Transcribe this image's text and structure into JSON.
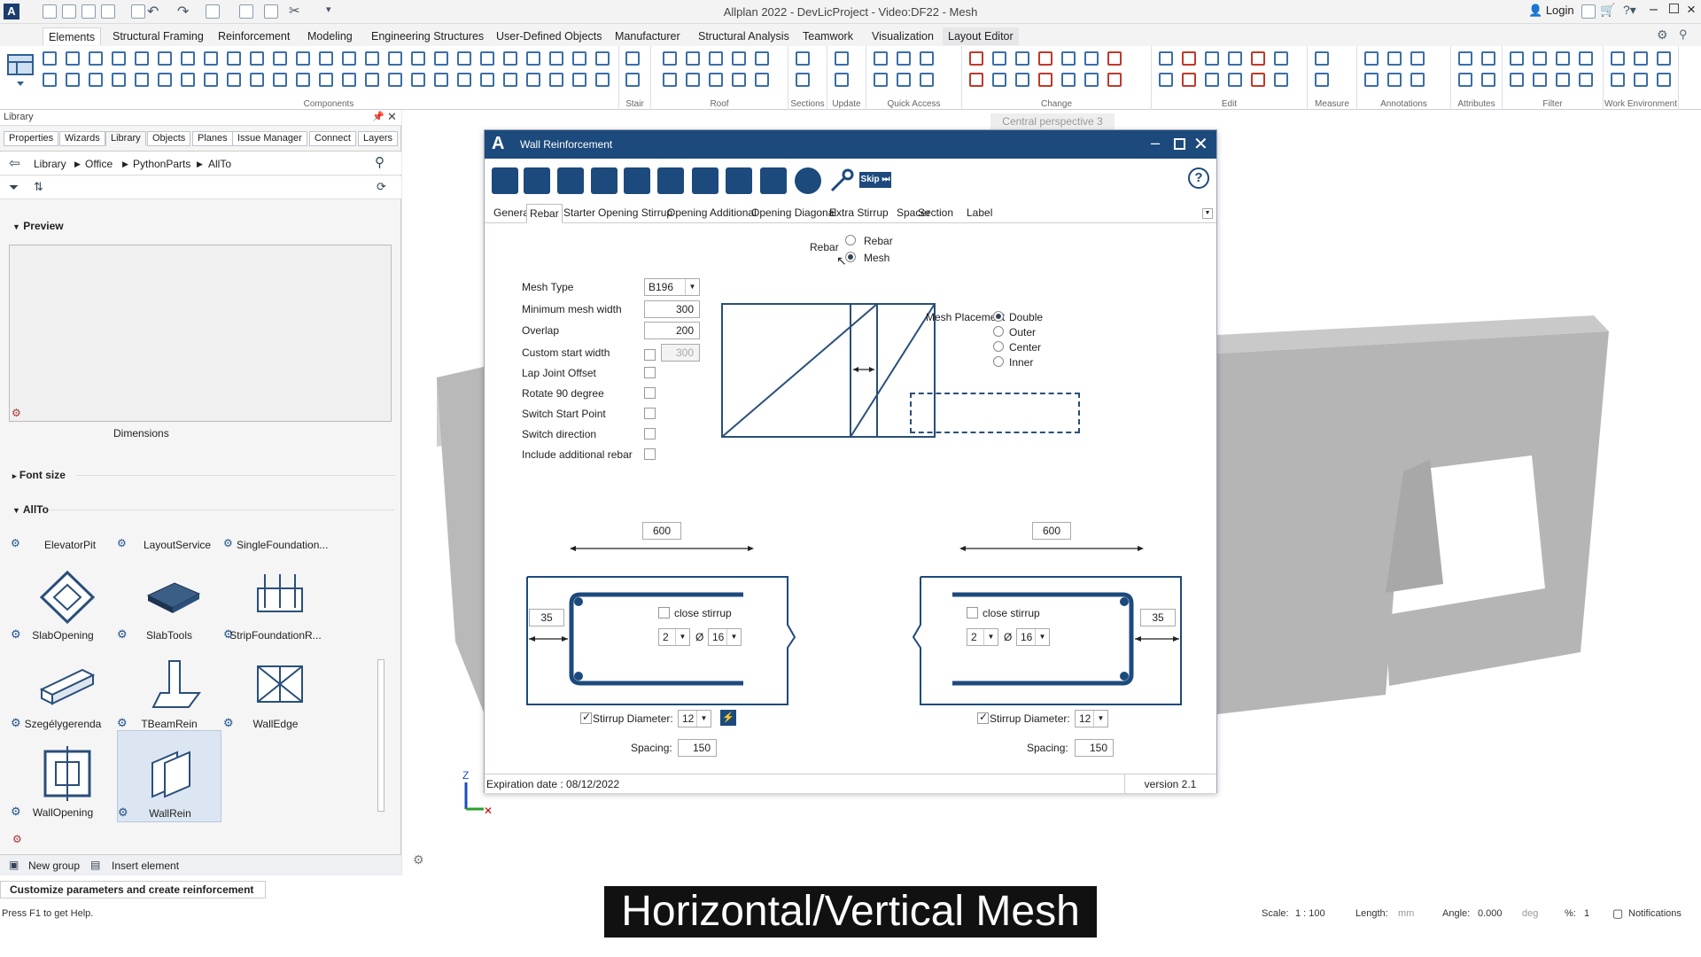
{
  "app": {
    "title": "Allplan 2022 - DevLicProject - Video:DF22 - Mesh",
    "login": "Login"
  },
  "ribbon": {
    "tabs": [
      "Elements",
      "Structural Framing",
      "Reinforcement",
      "Modeling",
      "Engineering Structures",
      "User-Defined Objects",
      "Manufacturer",
      "Structural Analysis",
      "Teamwork",
      "Visualization",
      "Layout Editor"
    ],
    "groups": [
      "Components",
      "Stair",
      "Roof",
      "Sections",
      "Update",
      "Quick Access",
      "Change",
      "Edit",
      "Measure",
      "Annotations",
      "Attributes",
      "Filter",
      "Work Environment"
    ]
  },
  "left_panel": {
    "header": "Library",
    "tabs": [
      "Properties",
      "Wizards",
      "Library",
      "Objects",
      "Planes",
      "Issue Manager",
      "Connect",
      "Layers"
    ],
    "breadcrumb": [
      "Library",
      "Office",
      "PythonParts",
      "AllTo"
    ],
    "preview_label": "Preview",
    "dimensions_label": "Dimensions",
    "font_size_label": "Font size",
    "group_label": "AllTo",
    "top_items": [
      "ElevatorPit",
      "LayoutService",
      "SingleFoundation..."
    ],
    "items": [
      "SlabOpening",
      "SlabTools",
      "StripFoundationR...",
      "Szegélygerenda",
      "TBeamRein",
      "WallEdge",
      "WallOpening",
      "WallRein"
    ],
    "new_group": "New group",
    "insert_element": "Insert element"
  },
  "viewport": {
    "tab": "Central perspective 3"
  },
  "dialog": {
    "title": "Wall Reinforcement",
    "skip": "Skip",
    "tabs": [
      "General",
      "Rebar",
      "Starter",
      "Opening Stirrup",
      "Opening Additional",
      "Opening Diagonal",
      "Extra Stirrup",
      "Spacer",
      "Section",
      "Label"
    ],
    "rebar_label": "Rebar",
    "rebar_options": [
      "Rebar",
      "Mesh"
    ],
    "mesh_type_label": "Mesh Type",
    "mesh_type": "B196",
    "min_mesh_width_label": "Minimum mesh width",
    "min_mesh_width": "300",
    "overlap_label": "Overlap",
    "overlap": "200",
    "custom_start_label": "Custom start width",
    "custom_start": "300",
    "lap_joint_label": "Lap Joint Offset",
    "rotate_label": "Rotate 90 degree",
    "switch_start_label": "Switch Start Point",
    "switch_dir_label": "Switch direction",
    "include_add_label": "Include additional rebar",
    "mesh_placement_label": "Mesh Placement",
    "mesh_placement_options": [
      "Double",
      "Outer",
      "Center",
      "Inner"
    ],
    "left_stirrup": {
      "length": "600",
      "offset": "35",
      "close": "close stirrup",
      "count": "2",
      "dia_sym": "Ø",
      "dia": "16",
      "stirrup_dia_label": "Stirrup Diameter:",
      "stirrup_dia": "12",
      "spacing_label": "Spacing:",
      "spacing": "150"
    },
    "right_stirrup": {
      "length": "600",
      "offset": "35",
      "close": "close stirrup",
      "count": "2",
      "dia_sym": "Ø",
      "dia": "16",
      "stirrup_dia_label": "Stirrup Diameter:",
      "stirrup_dia": "12",
      "spacing_label": "Spacing:",
      "spacing": "150"
    },
    "expiration": "Expiration date : 08/12/2022",
    "version": "version 2.1"
  },
  "status": {
    "prompt": "Customize parameters and create reinforcement",
    "help": "Press F1 to get Help.",
    "scale_label": "Scale:",
    "scale": "1 : 100",
    "length_label": "Length:",
    "length_unit": "mm",
    "angle_label": "Angle:",
    "angle": "0.000",
    "angle_unit": "deg",
    "percent_label": "%:",
    "percent": "1",
    "notifications": "Notifications"
  },
  "caption": "Horizontal/Vertical Mesh",
  "colors": {
    "accent": "#1d4a7c",
    "ribbon_icon": "#3b6ea8",
    "red_icon": "#c0392b"
  }
}
